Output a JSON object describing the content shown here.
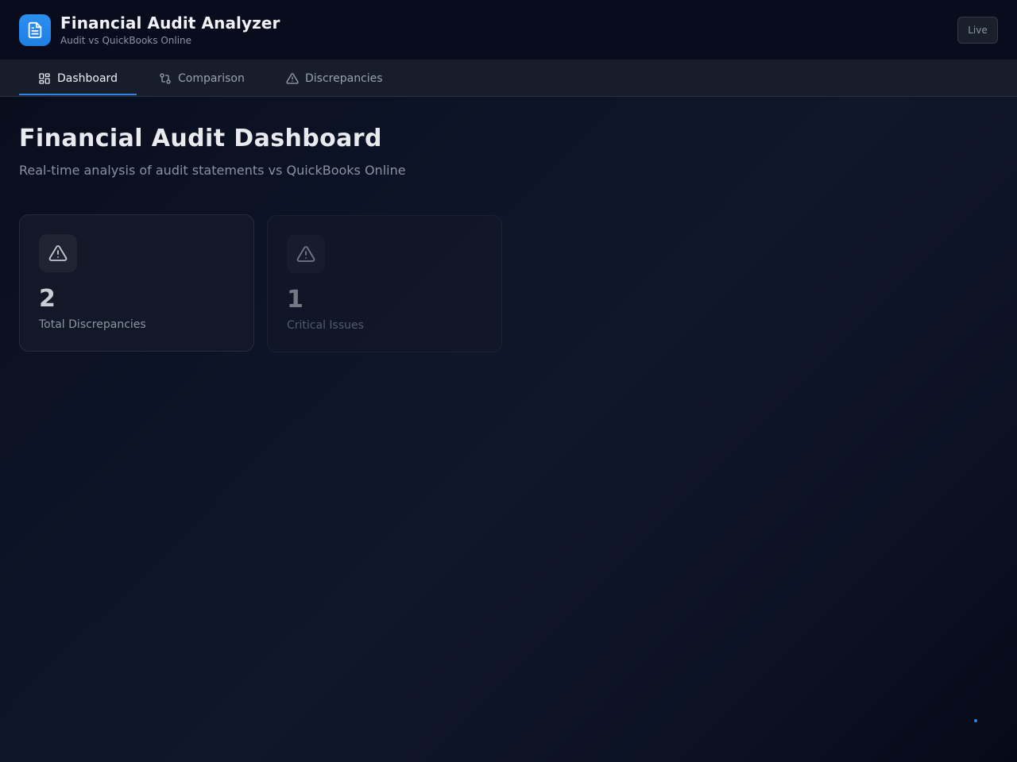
{
  "header": {
    "title": "Financial Audit Analyzer",
    "subtitle": "Audit vs QuickBooks Online",
    "status_badge": "Live",
    "logo_icon": "document-icon",
    "brand_color": "#2689ea"
  },
  "tabs": [
    {
      "label": "Dashboard",
      "icon": "grid-icon",
      "active": true
    },
    {
      "label": "Comparison",
      "icon": "compare-arrows-icon",
      "active": false
    },
    {
      "label": "Discrepancies",
      "icon": "warning-icon",
      "active": false
    }
  ],
  "main": {
    "title": "Financial Audit Dashboard",
    "subtitle": "Real-time analysis of audit statements vs QuickBooks Online",
    "stats": [
      {
        "value": "2",
        "label": "Total Discrepancies",
        "icon": "warning-icon"
      },
      {
        "value": "1",
        "label": "Critical Issues",
        "icon": "warning-icon"
      }
    ]
  }
}
